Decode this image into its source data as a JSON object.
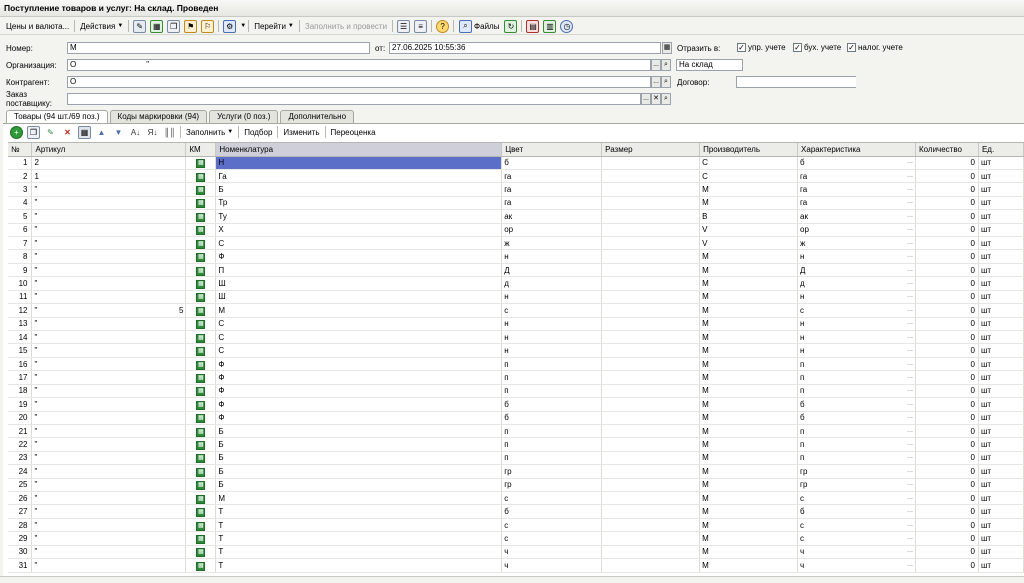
{
  "window": {
    "title": "Поступление товаров и услуг: На склад. Проведен"
  },
  "toolbar": {
    "prices_label": "Цены и валюта...",
    "actions_label": "Действия",
    "goto_label": "Перейти",
    "fill_post_label": "Заполнить и провести",
    "files_label": "Файлы"
  },
  "form": {
    "number_label": "Номер:",
    "number_value": "М",
    "date_label": "от:",
    "date_value": "27.06.2025 10:55:36",
    "reflect_label": "Отразить в:",
    "chk_upr": "упр. учете",
    "chk_buh": "бух. учете",
    "chk_nalog": "налог. учете",
    "org_label": "Организация:",
    "org_value": "О",
    "org_tail": "\"",
    "warehouse_value": "На склад",
    "counterparty_label": "Контрагент:",
    "counterparty_value": "О",
    "contract_label": "Договор:",
    "order_label": "Заказ поставщику:"
  },
  "tabs": [
    {
      "label": "Товары (94 шт./69 поз.)"
    },
    {
      "label": "Коды маркировки (94)"
    },
    {
      "label": "Услуги (0 поз.)"
    },
    {
      "label": "Дополнительно"
    }
  ],
  "table_toolbar": {
    "fill_label": "Заполнить",
    "select_label": "Подбор",
    "change_label": "Изменить",
    "reprice_label": "Переоценка"
  },
  "table": {
    "columns": [
      "№",
      "Артикул",
      "КМ",
      "Номенклатура",
      "Цвет",
      "Размер",
      "Производитель",
      "Характеристика",
      "Количество",
      "Ед."
    ],
    "rows": [
      {
        "n": "1",
        "art": "2",
        "nom": "Н",
        "color": "б",
        "maker": "С",
        "char": "б",
        "qty": "0",
        "unit": "шт"
      },
      {
        "n": "2",
        "art": "1",
        "nom": "Га",
        "color": "га",
        "maker": "С",
        "char": "га",
        "qty": "0",
        "unit": "шт"
      },
      {
        "n": "3",
        "art": "\"",
        "nom": "Б",
        "color": "га",
        "maker": "М",
        "char": "га",
        "qty": "0",
        "unit": "шт"
      },
      {
        "n": "4",
        "art": "\"",
        "nom": "Тр",
        "color": "га",
        "maker": "М",
        "char": "га",
        "qty": "0",
        "unit": "шт"
      },
      {
        "n": "5",
        "art": "\"",
        "nom": "Ту",
        "color": "ак",
        "maker": "В",
        "char": "ак",
        "qty": "0",
        "unit": "шт"
      },
      {
        "n": "6",
        "art": "\"",
        "nom": "Х",
        "color": "ор",
        "maker": "V",
        "char": "ор",
        "qty": "0",
        "unit": "шт"
      },
      {
        "n": "7",
        "art": "\"",
        "nom": "С",
        "color": "ж",
        "maker": "V",
        "char": "ж",
        "qty": "0",
        "unit": "шт"
      },
      {
        "n": "8",
        "art": "\"",
        "nom": "Ф",
        "color": "н",
        "maker": "М",
        "char": "н",
        "qty": "0",
        "unit": "шт"
      },
      {
        "n": "9",
        "art": "\"",
        "nom": "П",
        "color": "Д",
        "maker": "М",
        "char": "Д",
        "qty": "0",
        "unit": "шт"
      },
      {
        "n": "10",
        "art": "\"",
        "nom": "Ш",
        "color": "д",
        "maker": "М",
        "char": "д",
        "qty": "0",
        "unit": "шт"
      },
      {
        "n": "11",
        "art": "\"",
        "nom": "Ш",
        "color": "н",
        "maker": "М",
        "char": "н",
        "qty": "0",
        "unit": "шт"
      },
      {
        "n": "12",
        "art": "\"",
        "art_tail": "5",
        "nom": "М",
        "color": "с",
        "maker": "М",
        "char": "с",
        "qty": "0",
        "unit": "шт"
      },
      {
        "n": "13",
        "art": "\"",
        "nom": "С",
        "color": "н",
        "maker": "М",
        "char": "н",
        "qty": "0",
        "unit": "шт"
      },
      {
        "n": "14",
        "art": "\"",
        "nom": "С",
        "color": "н",
        "maker": "М",
        "char": "н",
        "qty": "0",
        "unit": "шт"
      },
      {
        "n": "15",
        "art": "\"",
        "nom": "С",
        "color": "н",
        "maker": "М",
        "char": "н",
        "qty": "0",
        "unit": "шт"
      },
      {
        "n": "16",
        "art": "\"",
        "nom": "Ф",
        "color": "п",
        "maker": "М",
        "char": "п",
        "qty": "0",
        "unit": "шт"
      },
      {
        "n": "17",
        "art": "\"",
        "nom": "Ф",
        "color": "п",
        "maker": "М",
        "char": "п",
        "qty": "0",
        "unit": "шт"
      },
      {
        "n": "18",
        "art": "\"",
        "nom": "Ф",
        "color": "п",
        "maker": "М",
        "char": "п",
        "qty": "0",
        "unit": "шт"
      },
      {
        "n": "19",
        "art": "\"",
        "nom": "Ф",
        "color": "б",
        "maker": "М",
        "char": "б",
        "qty": "0",
        "unit": "шт"
      },
      {
        "n": "20",
        "art": "\"",
        "nom": "Ф",
        "color": "б",
        "maker": "М",
        "char": "б",
        "qty": "0",
        "unit": "шт"
      },
      {
        "n": "21",
        "art": "\"",
        "nom": "Б",
        "color": "п",
        "maker": "М",
        "char": "п",
        "qty": "0",
        "unit": "шт"
      },
      {
        "n": "22",
        "art": "\"",
        "nom": "Б",
        "color": "п",
        "maker": "М",
        "char": "п",
        "qty": "0",
        "unit": "шт"
      },
      {
        "n": "23",
        "art": "\"",
        "nom": "Б",
        "color": "п",
        "maker": "М",
        "char": "п",
        "qty": "0",
        "unit": "шт"
      },
      {
        "n": "24",
        "art": "\"",
        "nom": "Б",
        "color": "гр",
        "maker": "М",
        "char": "гр",
        "qty": "0",
        "unit": "шт"
      },
      {
        "n": "25",
        "art": "\"",
        "nom": "Б",
        "color": "гр",
        "maker": "М",
        "char": "гр",
        "qty": "0",
        "unit": "шт"
      },
      {
        "n": "26",
        "art": "\"",
        "nom": "М",
        "color": "с",
        "maker": "М",
        "char": "с",
        "qty": "0",
        "unit": "шт"
      },
      {
        "n": "27",
        "art": "\"",
        "nom": "Т",
        "color": "б",
        "maker": "М",
        "char": "б",
        "qty": "0",
        "unit": "шт"
      },
      {
        "n": "28",
        "art": "\"",
        "nom": "Т",
        "color": "с",
        "maker": "М",
        "char": "с",
        "qty": "0",
        "unit": "шт"
      },
      {
        "n": "29",
        "art": "\"",
        "nom": "Т",
        "color": "с",
        "maker": "М",
        "char": "с",
        "qty": "0",
        "unit": "шт"
      },
      {
        "n": "30",
        "art": "\"",
        "nom": "Т",
        "color": "ч",
        "maker": "М",
        "char": "ч",
        "qty": "0",
        "unit": "шт"
      },
      {
        "n": "31",
        "art": "\"",
        "nom": "Т",
        "color": "ч",
        "maker": "М",
        "char": "ч",
        "qty": "0",
        "unit": "шт"
      }
    ]
  },
  "colors": {
    "selection": "#5b6fc8",
    "km_green": "#2e8b3a",
    "sorted_header": "#cfcfd9"
  }
}
